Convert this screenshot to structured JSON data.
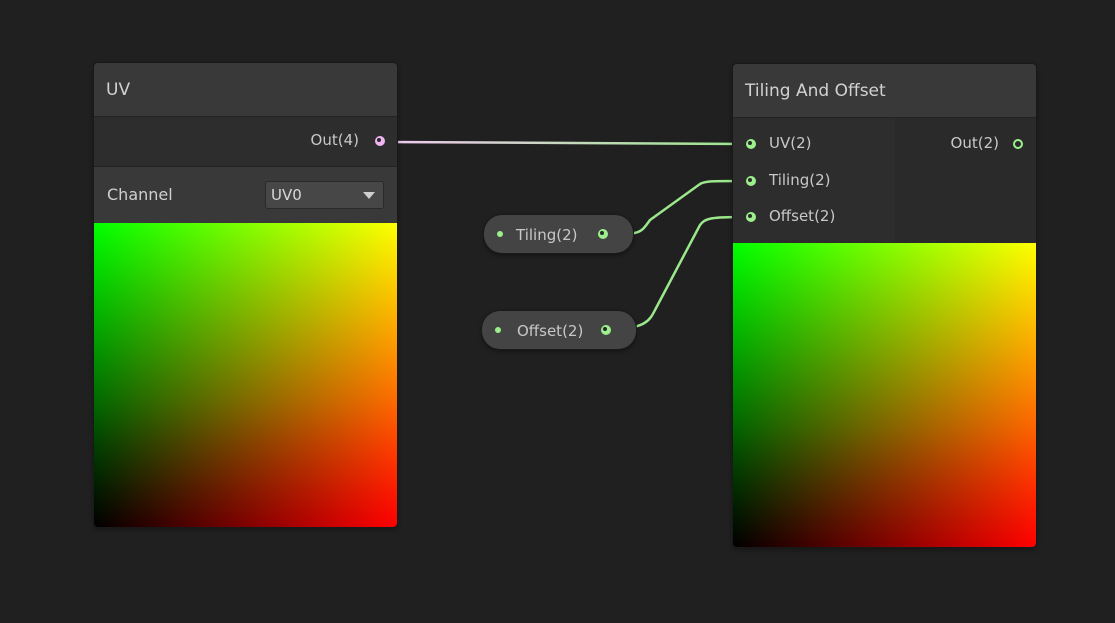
{
  "uv_node": {
    "title": "UV",
    "output_label": "Out(4)",
    "channel_label": "Channel",
    "channel_value": "UV0"
  },
  "tiling_node": {
    "title": "Tiling And Offset",
    "inputs": [
      "UV(2)",
      "Tiling(2)",
      "Offset(2)"
    ],
    "output_label": "Out(2)"
  },
  "properties": {
    "tiling": "Tiling(2)",
    "offset": "Offset(2)"
  },
  "colors": {
    "vector4_port": "#f0b4f0",
    "vector2_port": "#9bf08c",
    "edge_green": "#9be88c",
    "edge_pink": "#f0c8f0"
  },
  "icons": {
    "dropdown": "chevron-down-icon"
  }
}
